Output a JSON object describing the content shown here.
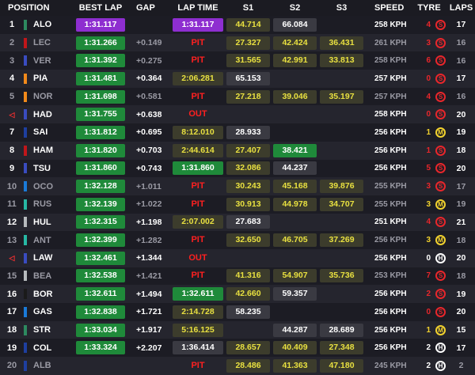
{
  "header": {
    "position": "POSITION",
    "best_lap": "BEST LAP",
    "gap": "GAP",
    "lap_time": "LAP TIME",
    "s1": "S1",
    "s2": "S2",
    "s3": "S3",
    "speed": "SPEED",
    "tyre": "TYRE",
    "laps": "LAPS"
  },
  "colors": {
    "purple": "#8e2ed0",
    "green": "#1f8a3a",
    "yellow_text": "#e8e040",
    "yellow_bg": "#3c3c2c",
    "neutral_bg": "#3a3a42",
    "soft": "#e8262b",
    "medium": "#f2d22e",
    "hard": "#ffffff",
    "pit": "#ff2020"
  },
  "rows": [
    {
      "pos": "1",
      "team": "#2d8a5f",
      "driver": "ALO",
      "best": "1:31.117",
      "best_style": "purple",
      "gap": "",
      "lap": "1:31.117",
      "lap_style": "purple",
      "s1": "44.714",
      "s1_style": "yellow",
      "s2": "66.084",
      "s2_style": "neutral",
      "s3": "",
      "s3_style": "none",
      "speed": "258 KPH",
      "tyre_age": "4",
      "tyre": "S",
      "laps": "17",
      "dim": false,
      "retired": false
    },
    {
      "pos": "2",
      "team": "#c0161a",
      "driver": "LEC",
      "best": "1:31.266",
      "best_style": "green",
      "gap": "+0.149",
      "lap": "PIT",
      "lap_style": "pit",
      "s1": "27.327",
      "s1_style": "yellow",
      "s2": "42.424",
      "s2_style": "yellow",
      "s3": "36.431",
      "s3_style": "yellow",
      "speed": "261 KPH",
      "tyre_age": "3",
      "tyre": "S",
      "laps": "16",
      "dim": true,
      "retired": false
    },
    {
      "pos": "3",
      "team": "#3a4cc0",
      "driver": "VER",
      "best": "1:31.392",
      "best_style": "green",
      "gap": "+0.275",
      "lap": "PIT",
      "lap_style": "pit",
      "s1": "31.565",
      "s1_style": "yellow",
      "s2": "42.991",
      "s2_style": "yellow",
      "s3": "33.813",
      "s3_style": "yellow",
      "speed": "258 KPH",
      "tyre_age": "6",
      "tyre": "S",
      "laps": "16",
      "dim": true,
      "retired": false
    },
    {
      "pos": "4",
      "team": "#f28a1a",
      "driver": "PIA",
      "best": "1:31.481",
      "best_style": "green",
      "gap": "+0.364",
      "lap": "2:06.281",
      "lap_style": "yellow",
      "s1": "65.153",
      "s1_style": "neutral",
      "s2": "",
      "s2_style": "none",
      "s3": "",
      "s3_style": "none",
      "speed": "257 KPH",
      "tyre_age": "0",
      "tyre": "S",
      "laps": "17",
      "dim": false,
      "retired": false
    },
    {
      "pos": "5",
      "team": "#f28a1a",
      "driver": "NOR",
      "best": "1:31.698",
      "best_style": "green",
      "gap": "+0.581",
      "lap": "PIT",
      "lap_style": "pit",
      "s1": "27.218",
      "s1_style": "yellow",
      "s2": "39.046",
      "s2_style": "yellow",
      "s3": "35.197",
      "s3_style": "yellow",
      "speed": "257 KPH",
      "tyre_age": "4",
      "tyre": "S",
      "laps": "16",
      "dim": true,
      "retired": false
    },
    {
      "pos": "",
      "team": "#3a4cc0",
      "driver": "HAD",
      "best": "1:31.755",
      "best_style": "green",
      "gap": "+0.638",
      "lap": "OUT",
      "lap_style": "pit",
      "s1": "",
      "s1_style": "none",
      "s2": "",
      "s2_style": "none",
      "s3": "",
      "s3_style": "none",
      "speed": "258 KPH",
      "tyre_age": "0",
      "tyre": "S",
      "laps": "20",
      "dim": false,
      "retired": true
    },
    {
      "pos": "7",
      "team": "#1e3fa0",
      "driver": "SAI",
      "best": "1:31.812",
      "best_style": "green",
      "gap": "+0.695",
      "lap": "8:12.010",
      "lap_style": "yellow",
      "s1": "28.933",
      "s1_style": "neutral",
      "s2": "",
      "s2_style": "none",
      "s3": "",
      "s3_style": "none",
      "speed": "256 KPH",
      "tyre_age": "1",
      "tyre": "M",
      "laps": "19",
      "dim": false,
      "retired": false
    },
    {
      "pos": "8",
      "team": "#c0161a",
      "driver": "HAM",
      "best": "1:31.820",
      "best_style": "green",
      "gap": "+0.703",
      "lap": "2:44.614",
      "lap_style": "yellow",
      "s1": "27.407",
      "s1_style": "yellow",
      "s2": "38.421",
      "s2_style": "green",
      "s3": "",
      "s3_style": "none",
      "speed": "256 KPH",
      "tyre_age": "1",
      "tyre": "S",
      "laps": "18",
      "dim": false,
      "retired": false
    },
    {
      "pos": "9",
      "team": "#3a4cc0",
      "driver": "TSU",
      "best": "1:31.860",
      "best_style": "green",
      "gap": "+0.743",
      "lap": "1:31.860",
      "lap_style": "green",
      "s1": "32.086",
      "s1_style": "yellow",
      "s2": "44.237",
      "s2_style": "neutral",
      "s3": "",
      "s3_style": "none",
      "speed": "256 KPH",
      "tyre_age": "5",
      "tyre": "S",
      "laps": "20",
      "dim": false,
      "retired": false
    },
    {
      "pos": "10",
      "team": "#1a7ad8",
      "driver": "OCO",
      "best": "1:32.128",
      "best_style": "green",
      "gap": "+1.011",
      "lap": "PIT",
      "lap_style": "pit",
      "s1": "30.243",
      "s1_style": "yellow",
      "s2": "45.168",
      "s2_style": "yellow",
      "s3": "39.876",
      "s3_style": "yellow",
      "speed": "255 KPH",
      "tyre_age": "3",
      "tyre": "S",
      "laps": "17",
      "dim": true,
      "retired": false
    },
    {
      "pos": "11",
      "team": "#27b8a4",
      "driver": "RUS",
      "best": "1:32.139",
      "best_style": "green",
      "gap": "+1.022",
      "lap": "PIT",
      "lap_style": "pit",
      "s1": "30.913",
      "s1_style": "yellow",
      "s2": "44.978",
      "s2_style": "yellow",
      "s3": "34.707",
      "s3_style": "yellow",
      "speed": "255 KPH",
      "tyre_age": "3",
      "tyre": "M",
      "laps": "19",
      "dim": true,
      "retired": false
    },
    {
      "pos": "12",
      "team": "#b6babd",
      "driver": "HUL",
      "best": "1:32.315",
      "best_style": "green",
      "gap": "+1.198",
      "lap": "2:07.002",
      "lap_style": "yellow",
      "s1": "27.683",
      "s1_style": "neutral",
      "s2": "",
      "s2_style": "none",
      "s3": "",
      "s3_style": "none",
      "speed": "251 KPH",
      "tyre_age": "4",
      "tyre": "S",
      "laps": "21",
      "dim": false,
      "retired": false
    },
    {
      "pos": "13",
      "team": "#27b8a4",
      "driver": "ANT",
      "best": "1:32.399",
      "best_style": "green",
      "gap": "+1.282",
      "lap": "PIT",
      "lap_style": "pit",
      "s1": "32.650",
      "s1_style": "yellow",
      "s2": "46.705",
      "s2_style": "yellow",
      "s3": "37.269",
      "s3_style": "yellow",
      "speed": "256 KPH",
      "tyre_age": "3",
      "tyre": "M",
      "laps": "18",
      "dim": true,
      "retired": false
    },
    {
      "pos": "",
      "team": "#3a4cc0",
      "driver": "LAW",
      "best": "1:32.461",
      "best_style": "green",
      "gap": "+1.344",
      "lap": "OUT",
      "lap_style": "pit",
      "s1": "",
      "s1_style": "none",
      "s2": "",
      "s2_style": "none",
      "s3": "",
      "s3_style": "none",
      "speed": "256 KPH",
      "tyre_age": "0",
      "tyre": "H",
      "laps": "20",
      "dim": false,
      "retired": true
    },
    {
      "pos": "15",
      "team": "#b6babd",
      "driver": "BEA",
      "best": "1:32.538",
      "best_style": "green",
      "gap": "+1.421",
      "lap": "PIT",
      "lap_style": "pit",
      "s1": "41.316",
      "s1_style": "yellow",
      "s2": "54.907",
      "s2_style": "yellow",
      "s3": "35.736",
      "s3_style": "yellow",
      "speed": "253 KPH",
      "tyre_age": "7",
      "tyre": "S",
      "laps": "18",
      "dim": true,
      "retired": false
    },
    {
      "pos": "16",
      "team": "#1a1a1a",
      "driver": "BOR",
      "best": "1:32.611",
      "best_style": "green",
      "gap": "+1.494",
      "lap": "1:32.611",
      "lap_style": "green",
      "s1": "42.660",
      "s1_style": "yellow",
      "s2": "59.357",
      "s2_style": "neutral",
      "s3": "",
      "s3_style": "none",
      "speed": "256 KPH",
      "tyre_age": "2",
      "tyre": "S",
      "laps": "19",
      "dim": false,
      "retired": false
    },
    {
      "pos": "17",
      "team": "#1a7ad8",
      "driver": "GAS",
      "best": "1:32.838",
      "best_style": "green",
      "gap": "+1.721",
      "lap": "2:14.728",
      "lap_style": "yellow",
      "s1": "58.235",
      "s1_style": "neutral",
      "s2": "",
      "s2_style": "none",
      "s3": "",
      "s3_style": "none",
      "speed": "256 KPH",
      "tyre_age": "0",
      "tyre": "S",
      "laps": "20",
      "dim": false,
      "retired": false
    },
    {
      "pos": "18",
      "team": "#2d8a5f",
      "driver": "STR",
      "best": "1:33.034",
      "best_style": "green",
      "gap": "+1.917",
      "lap": "5:16.125",
      "lap_style": "yellow",
      "s1": "",
      "s1_style": "none",
      "s2": "44.287",
      "s2_style": "neutral",
      "s3": "28.689",
      "s3_style": "neutral",
      "speed": "256 KPH",
      "tyre_age": "1",
      "tyre": "M",
      "laps": "15",
      "dim": false,
      "retired": false
    },
    {
      "pos": "19",
      "team": "#1e3fa0",
      "driver": "COL",
      "best": "1:33.324",
      "best_style": "green",
      "gap": "+2.207",
      "lap": "1:36.414",
      "lap_style": "neutral",
      "s1": "28.657",
      "s1_style": "yellow",
      "s2": "40.409",
      "s2_style": "yellow",
      "s3": "27.348",
      "s3_style": "yellow",
      "speed": "256 KPH",
      "tyre_age": "2",
      "tyre": "H",
      "laps": "17",
      "dim": false,
      "retired": false
    },
    {
      "pos": "20",
      "team": "#1e3fa0",
      "driver": "ALB",
      "best": "",
      "best_style": "none",
      "gap": "",
      "lap": "PIT",
      "lap_style": "pit",
      "s1": "28.486",
      "s1_style": "yellow",
      "s2": "41.363",
      "s2_style": "yellow",
      "s3": "47.180",
      "s3_style": "yellow",
      "speed": "245 KPH",
      "tyre_age": "2",
      "tyre": "H",
      "laps": "2",
      "dim": true,
      "retired": false
    }
  ]
}
